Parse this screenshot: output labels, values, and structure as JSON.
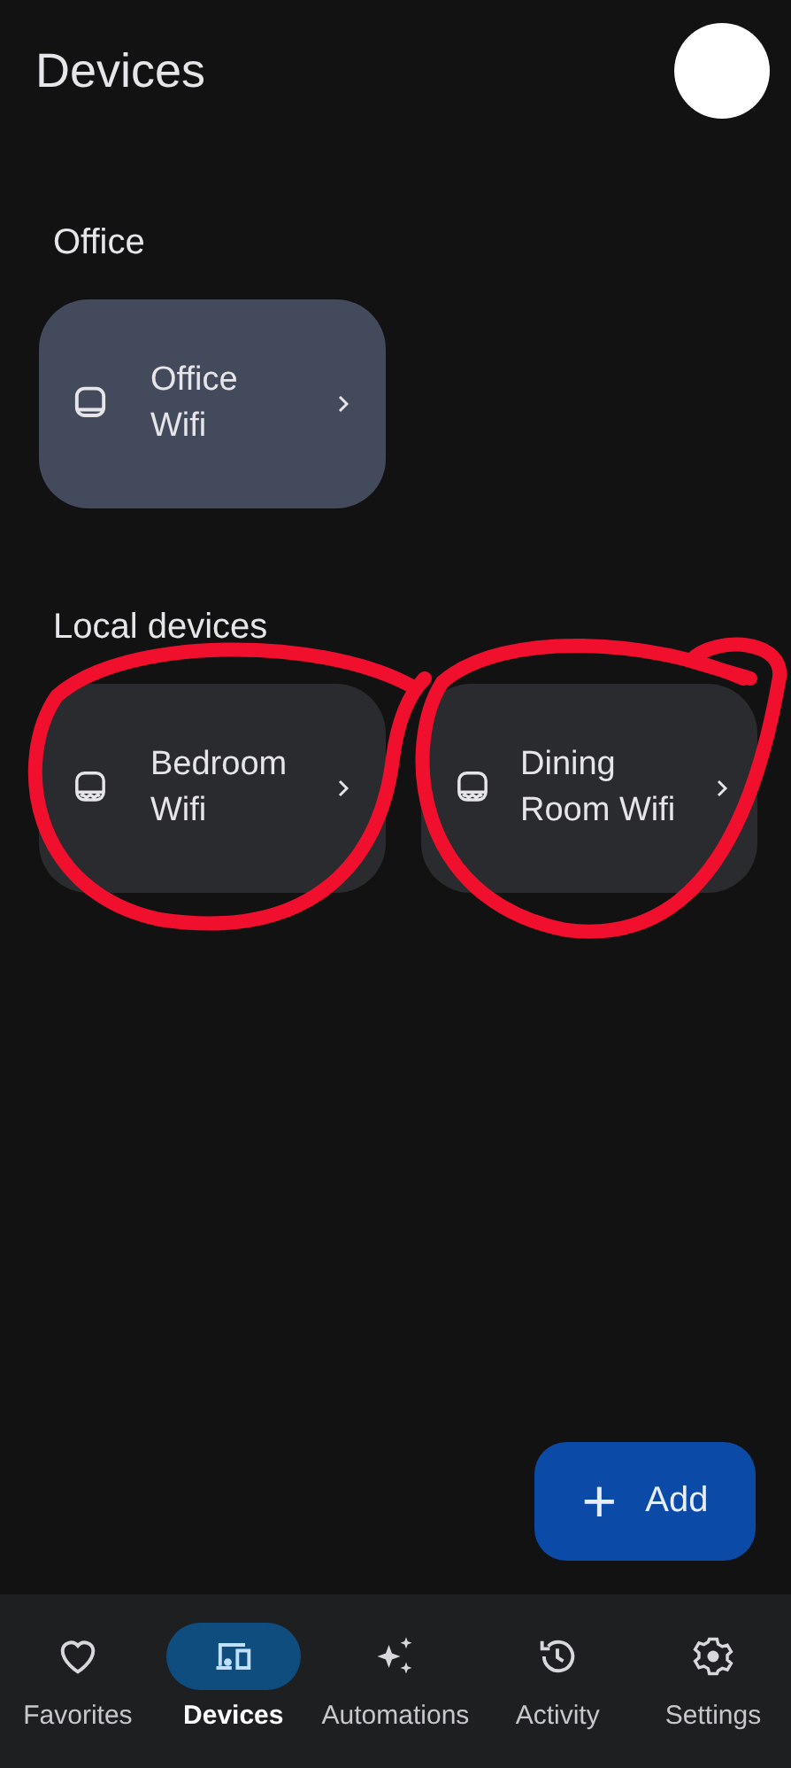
{
  "header": {
    "title": "Devices"
  },
  "sections": [
    {
      "title": "Office",
      "devices": [
        {
          "name": "Office Wifi",
          "kind": "router",
          "selected": true
        }
      ]
    },
    {
      "title": "Local devices",
      "devices": [
        {
          "name": "Bedroom Wifi",
          "kind": "point",
          "selected": false
        },
        {
          "name": "Dining Room Wifi",
          "kind": "point",
          "selected": false
        }
      ]
    }
  ],
  "annotations": [
    {
      "color": "#f0102e"
    },
    {
      "color": "#f0102e"
    }
  ],
  "fab": {
    "icon": "+",
    "label": "Add"
  },
  "nav": [
    {
      "label": "Favorites",
      "kind": "heart",
      "selected": false
    },
    {
      "label": "Devices",
      "kind": "devices",
      "selected": true
    },
    {
      "label": "Automations",
      "kind": "sparkle",
      "selected": false
    },
    {
      "label": "Activity",
      "kind": "history",
      "selected": false
    },
    {
      "label": "Settings",
      "kind": "gear",
      "selected": false
    }
  ]
}
